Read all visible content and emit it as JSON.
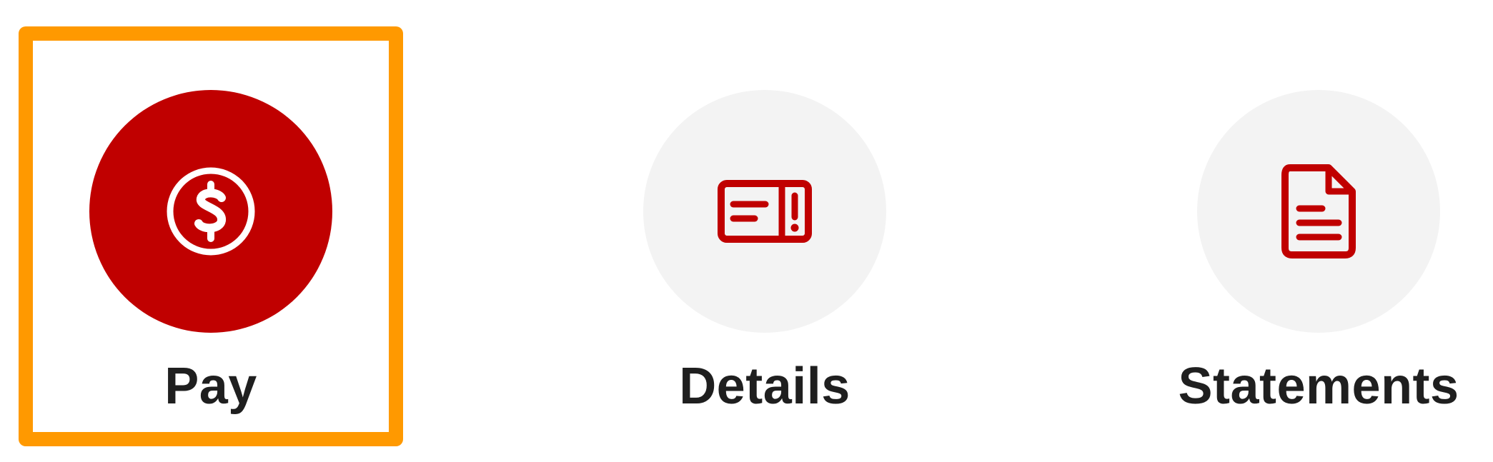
{
  "colors": {
    "accent": "#c00000",
    "inactive_circle": "#f3f3f3",
    "focus_ring": "#ff9900",
    "label_text": "#1f1f1f"
  },
  "actions": [
    {
      "label": "Pay",
      "icon": "dollar-coin-icon",
      "selected": true
    },
    {
      "label": "Details",
      "icon": "card-alert-icon",
      "selected": false
    },
    {
      "label": "Statements",
      "icon": "document-icon",
      "selected": false
    }
  ]
}
